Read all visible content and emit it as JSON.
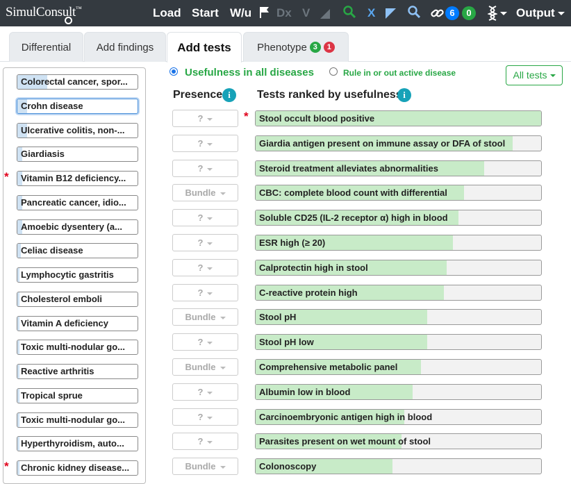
{
  "nav": {
    "logo": "SimulConsult",
    "load": "Load",
    "start": "Start",
    "wu": "W/u",
    "dx": "Dx",
    "v": "V",
    "x": "X",
    "badge_blue": "6",
    "badge_green": "0",
    "output": "Output"
  },
  "tabs": {
    "differential": "Differential",
    "add_findings": "Add findings",
    "add_tests": "Add tests",
    "phenotype": "Phenotype",
    "phenotype_badge_green": "3",
    "phenotype_badge_red": "1"
  },
  "diseases": [
    {
      "label": "Colorectal cancer, spor...",
      "level": 0.25,
      "star": false,
      "selected": false
    },
    {
      "label": "Crohn disease",
      "level": 0.08,
      "star": false,
      "selected": true
    },
    {
      "label": "Ulcerative colitis, non-...",
      "level": 0.08,
      "star": false,
      "selected": false
    },
    {
      "label": "Giardiasis",
      "level": 0.04,
      "star": false,
      "selected": false
    },
    {
      "label": "Vitamin B12 deficiency...",
      "level": 0.04,
      "star": true,
      "selected": false
    },
    {
      "label": "Pancreatic cancer, idio...",
      "level": 0.04,
      "star": false,
      "selected": false
    },
    {
      "label": "Amoebic dysentery (a...",
      "level": 0.04,
      "star": false,
      "selected": false
    },
    {
      "label": "Celiac disease",
      "level": 0.03,
      "star": false,
      "selected": false
    },
    {
      "label": "Lymphocytic gastritis",
      "level": 0.02,
      "star": false,
      "selected": false
    },
    {
      "label": "Cholesterol emboli",
      "level": 0.02,
      "star": false,
      "selected": false
    },
    {
      "label": "Vitamin A deficiency",
      "level": 0.02,
      "star": false,
      "selected": false
    },
    {
      "label": "Toxic multi-nodular go...",
      "level": 0.02,
      "star": false,
      "selected": false
    },
    {
      "label": "Reactive arthritis",
      "level": 0.02,
      "star": false,
      "selected": false
    },
    {
      "label": "Tropical sprue",
      "level": 0.02,
      "star": false,
      "selected": false
    },
    {
      "label": "Toxic multi-nodular go...",
      "level": 0.02,
      "star": false,
      "selected": false
    },
    {
      "label": "Hyperthyroidism, auto...",
      "level": 0.02,
      "star": false,
      "selected": false
    },
    {
      "label": "Chronic kidney disease...",
      "level": 0.02,
      "star": true,
      "selected": false
    }
  ],
  "options": {
    "usefulness_all": "Usefulness in all diseases",
    "rule_in_out": "Rule in or out active disease",
    "all_tests": "All tests",
    "selected": "usefulness_all"
  },
  "headers": {
    "presence": "Presence",
    "tests_ranked": "Tests ranked by usefulness",
    "info_glyph": "i"
  },
  "tests": [
    {
      "presence": "?",
      "label": "Stool occult blood positive",
      "usefulness": 1.0,
      "star": true
    },
    {
      "presence": "?",
      "label": "Giardia antigen present on immune assay or DFA of stool",
      "usefulness": 0.9,
      "star": false
    },
    {
      "presence": "?",
      "label": "Steroid treatment alleviates abnormalities",
      "usefulness": 0.8,
      "star": false
    },
    {
      "presence": "Bundle",
      "label": "CBC: complete blood count with differential",
      "usefulness": 0.73,
      "star": false
    },
    {
      "presence": "?",
      "label": "Soluble CD25 (IL-2 receptor α) high in blood",
      "usefulness": 0.71,
      "star": false
    },
    {
      "presence": "?",
      "label": "ESR high (≥ 20)",
      "usefulness": 0.69,
      "star": false
    },
    {
      "presence": "?",
      "label": "Calprotectin high in stool",
      "usefulness": 0.67,
      "star": false
    },
    {
      "presence": "?",
      "label": "C-reactive protein high",
      "usefulness": 0.66,
      "star": false
    },
    {
      "presence": "Bundle",
      "label": "Stool pH",
      "usefulness": 0.6,
      "star": false
    },
    {
      "presence": "?",
      "label": "Stool pH low",
      "usefulness": 0.6,
      "star": false
    },
    {
      "presence": "Bundle",
      "label": "Comprehensive metabolic panel",
      "usefulness": 0.58,
      "star": false
    },
    {
      "presence": "?",
      "label": "Albumin low in blood",
      "usefulness": 0.55,
      "star": false
    },
    {
      "presence": "?",
      "label": "Carcinoembryonic antigen high in blood",
      "usefulness": 0.52,
      "star": false
    },
    {
      "presence": "?",
      "label": "Parasites present on wet mount of stool",
      "usefulness": 0.51,
      "star": false
    },
    {
      "presence": "Bundle",
      "label": "Colonoscopy",
      "usefulness": 0.48,
      "star": false
    }
  ],
  "colors": {
    "nav_bg": "#343a40",
    "accent_green": "#28a745",
    "badge_blue": "#007bff",
    "badge_red": "#dc3545",
    "info": "#17a2b8",
    "disease_fill": "#cfe2f3",
    "test_fill": "#c8ebc8",
    "star": "#e0001b"
  }
}
